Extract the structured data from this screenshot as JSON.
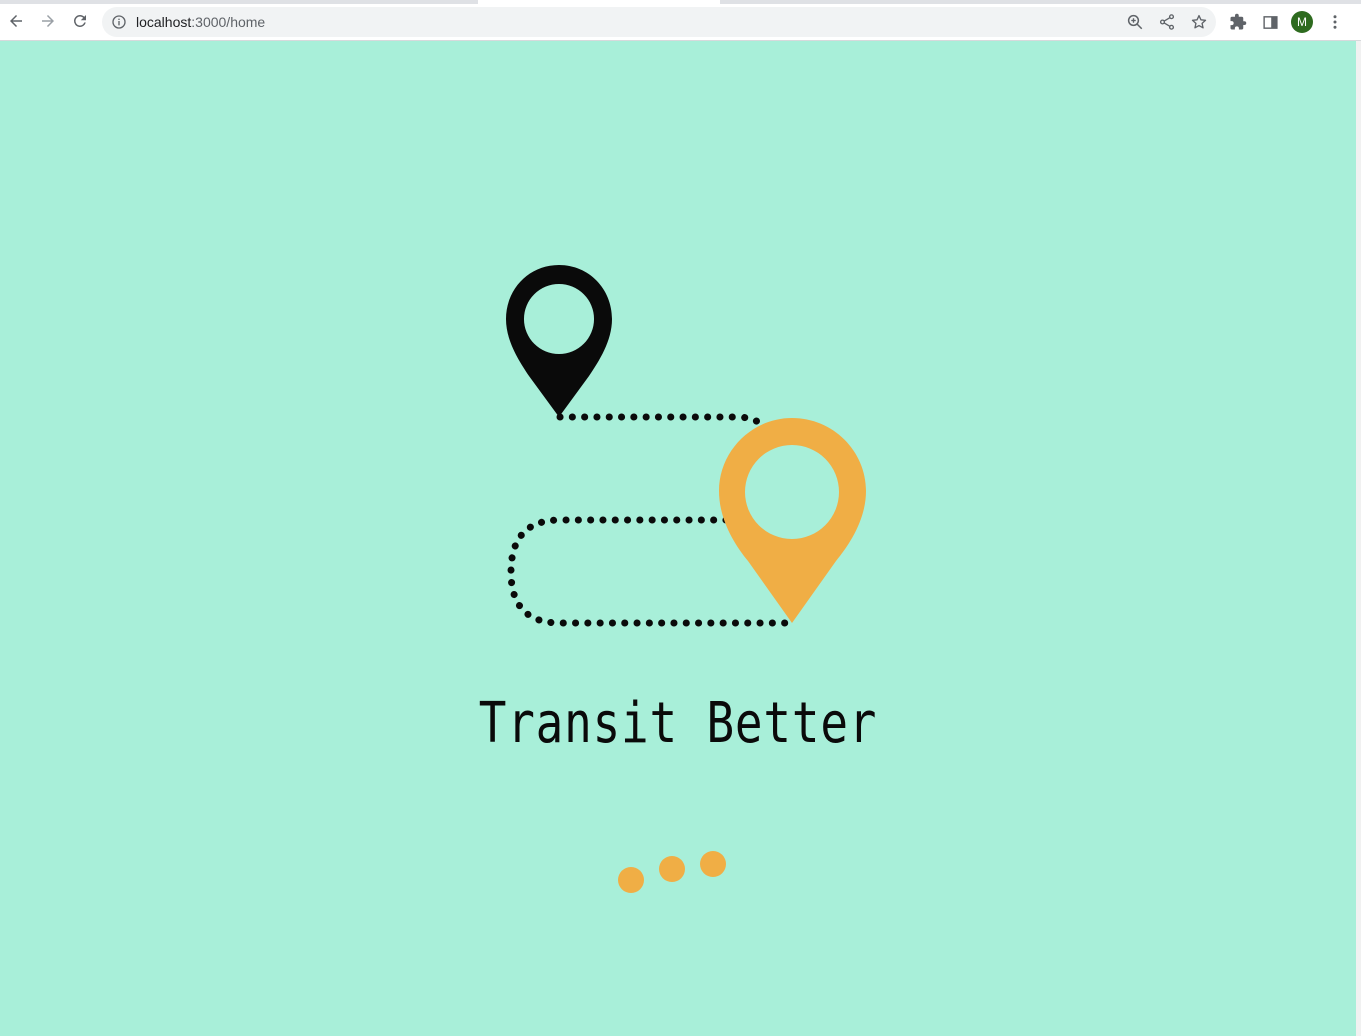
{
  "browser": {
    "url_host": "localhost",
    "url_path": ":3000/home",
    "profile_initial": "M"
  },
  "page": {
    "title": "Transit Better",
    "loading_dots": 3
  },
  "colors": {
    "background": "#a8efd9",
    "start_pin": "#0a0a0a",
    "destination_pin": "#f0ae45",
    "route": "#0a0a0a",
    "loader": "#f0ae45"
  },
  "icons": {
    "back": "arrow-left-icon",
    "forward": "arrow-right-icon",
    "reload": "reload-icon",
    "site_info": "info-icon",
    "zoom": "zoom-in-icon",
    "share": "share-icon",
    "bookmark": "star-icon",
    "extensions": "puzzle-icon",
    "side_panel": "side-panel-icon",
    "menu": "kebab-menu-icon",
    "start_pin": "map-pin-icon",
    "destination_pin": "map-pin-icon"
  }
}
